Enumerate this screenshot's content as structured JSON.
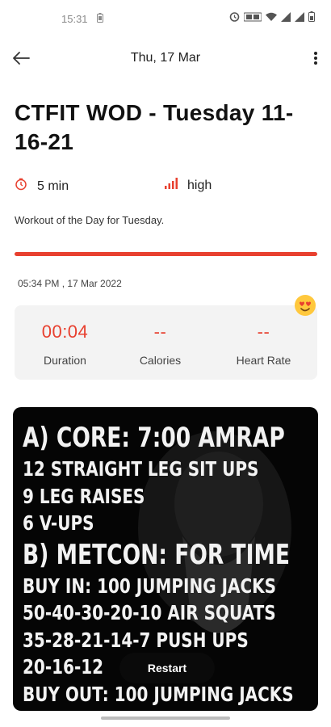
{
  "status_bar": {
    "time": "15:31"
  },
  "appbar": {
    "title": "Thu, 17 Mar"
  },
  "workout": {
    "title": "CTFIT WOD - Tuesday 11-16-21",
    "duration": "5 min",
    "intensity": "high",
    "description": "Workout of the Day for Tuesday.",
    "timestamp": "05:34 PM , 17 Mar 2022"
  },
  "stats": [
    {
      "value": "00:04",
      "label": "Duration"
    },
    {
      "value": "--",
      "label": "Calories"
    },
    {
      "value": "--",
      "label": "Heart Rate"
    }
  ],
  "wod_image_lines": [
    "A) CORE: 7:00 AMRAP",
    "12 STRAIGHT LEG SIT UPS",
    "9 LEG RAISES",
    "6 V-UPS",
    "B) METCON: FOR TIME",
    "BUY IN: 100 JUMPING JACKS",
    "50-40-30-20-10 AIR SQUATS",
    "35-28-21-14-7 PUSH UPS",
    "20-16-12",
    "BUY OUT: 100 JUMPING JACKS"
  ],
  "restart_label": "Restart",
  "colors": {
    "accent": "#e8402f",
    "card_bg": "#f3f3f3",
    "image_bg": "#050505"
  },
  "icons": {
    "back": "arrow-left-icon",
    "more": "more-vertical-icon",
    "duration": "timer-icon",
    "intensity": "signal-bars-icon",
    "emoji": "heart-eyes-emoji-icon"
  }
}
